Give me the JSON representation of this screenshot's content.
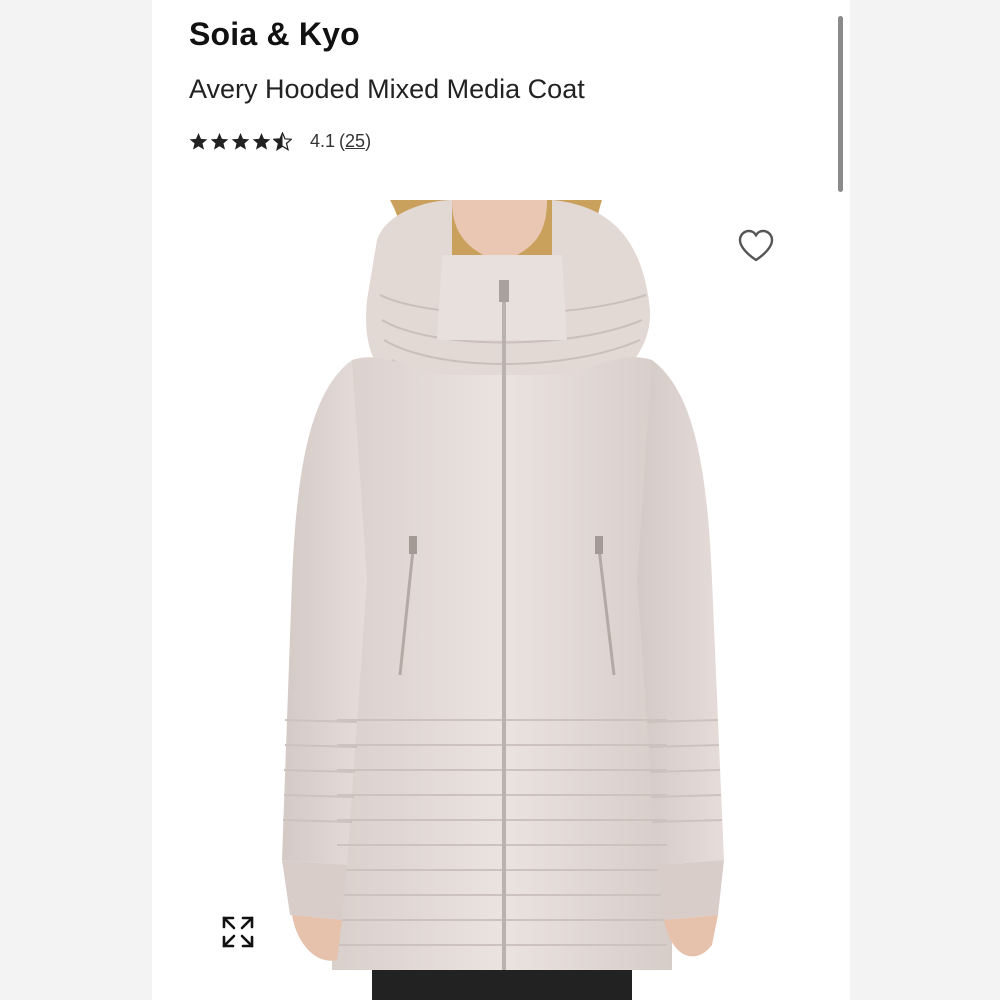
{
  "product": {
    "brand": "Soia & Kyo",
    "name": "Avery Hooded Mixed Media Coat",
    "rating": {
      "stars": 4.1,
      "value_text": "4.1",
      "open_paren": "(",
      "review_count": "25",
      "close_paren": ")"
    },
    "image": {
      "subject": "hooded quilted coat, light blush",
      "coat_color": "#e6dcd8"
    }
  },
  "icons": {
    "favorite": "heart-icon",
    "expand": "expand-icon",
    "star": "star-icon"
  },
  "colors": {
    "text_primary": "#111111",
    "background": "#ffffff",
    "side_panel": "#f3f3f3",
    "scrollbar": "#8a8a8a"
  }
}
